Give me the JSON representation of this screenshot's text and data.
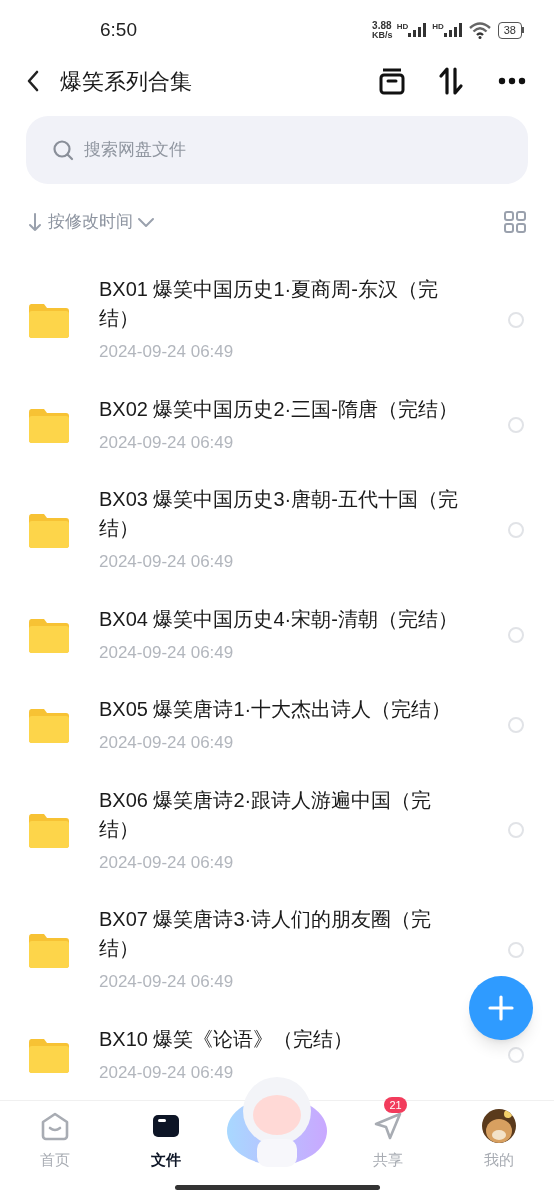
{
  "status_bar": {
    "time": "6:50",
    "speed_value": "3.88",
    "speed_unit": "KB/s",
    "sim_labels": [
      "HD",
      "HD"
    ],
    "battery": "38"
  },
  "header": {
    "title": "爆笑系列合集"
  },
  "search": {
    "placeholder": "搜索网盘文件"
  },
  "sort": {
    "label": "按修改时间"
  },
  "files": [
    {
      "name": "BX01 爆笑中国历史1·夏商周-东汉（完结）",
      "date": "2024-09-24  06:49",
      "selected": false
    },
    {
      "name": "BX02 爆笑中国历史2·三国-隋唐（完结）",
      "date": "2024-09-24  06:49",
      "selected": false
    },
    {
      "name": "BX03 爆笑中国历史3·唐朝-五代十国（完结）",
      "date": "2024-09-24  06:49",
      "selected": false
    },
    {
      "name": "BX04 爆笑中国历史4·宋朝-清朝（完结）",
      "date": "2024-09-24  06:49",
      "selected": false
    },
    {
      "name": "BX05 爆笑唐诗1·十大杰出诗人（完结）",
      "date": "2024-09-24  06:49",
      "selected": false
    },
    {
      "name": "BX06 爆笑唐诗2·跟诗人游遍中国（完结）",
      "date": "2024-09-24  06:49",
      "selected": false
    },
    {
      "name": "BX07 爆笑唐诗3·诗人们的朋友圈（完结）",
      "date": "2024-09-24  06:49",
      "selected": false
    },
    {
      "name": "BX10 爆笑《论语》（完结）",
      "date": "2024-09-24  06:49",
      "selected": false
    }
  ],
  "nav": [
    {
      "kind": "home",
      "label": "首页",
      "selected": false
    },
    {
      "kind": "files",
      "label": "文件",
      "selected": true
    },
    {
      "kind": "mascot"
    },
    {
      "kind": "share",
      "label": "共享",
      "selected": false,
      "badge": "21"
    },
    {
      "kind": "profile",
      "label": "我的",
      "selected": false
    }
  ]
}
